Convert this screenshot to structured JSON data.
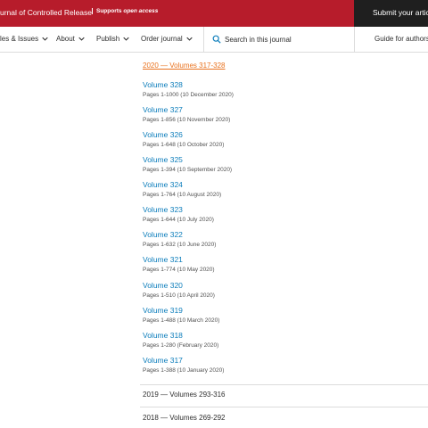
{
  "header": {
    "journal_title": "urnal of Controlled Release",
    "supports_prefix": "Supports ",
    "supports_emph": "open access",
    "submit_label": "Submit your article"
  },
  "nav": {
    "items": [
      "les & Issues",
      "About",
      "Publish",
      "Order journal"
    ],
    "search_placeholder": "Search in this journal",
    "guide_label": "Guide for authors"
  },
  "expanded_year": "2020 — Volumes 317-328",
  "volumes": [
    {
      "title": "Volume 328",
      "pages": "Pages 1-1000 (10 December 2020)"
    },
    {
      "title": "Volume 327",
      "pages": "Pages 1-856 (10 November 2020)"
    },
    {
      "title": "Volume 326",
      "pages": "Pages 1-648 (10 October 2020)"
    },
    {
      "title": "Volume 325",
      "pages": "Pages 1-394 (10 September 2020)"
    },
    {
      "title": "Volume 324",
      "pages": "Pages 1-764 (10 August 2020)"
    },
    {
      "title": "Volume 323",
      "pages": "Pages 1-644 (10 July 2020)"
    },
    {
      "title": "Volume 322",
      "pages": "Pages 1-632 (10 June 2020)"
    },
    {
      "title": "Volume 321",
      "pages": "Pages 1-774 (10 May 2020)"
    },
    {
      "title": "Volume 320",
      "pages": "Pages 1-510 (10 April 2020)"
    },
    {
      "title": "Volume 319",
      "pages": "Pages 1-488 (10 March 2020)"
    },
    {
      "title": "Volume 318",
      "pages": "Pages 1-280 (February 2020)"
    },
    {
      "title": "Volume 317",
      "pages": "Pages 1-388 (10 January 2020)"
    }
  ],
  "collapsed_years": [
    "2019 — Volumes 293-316",
    "2018 — Volumes 269-292"
  ]
}
